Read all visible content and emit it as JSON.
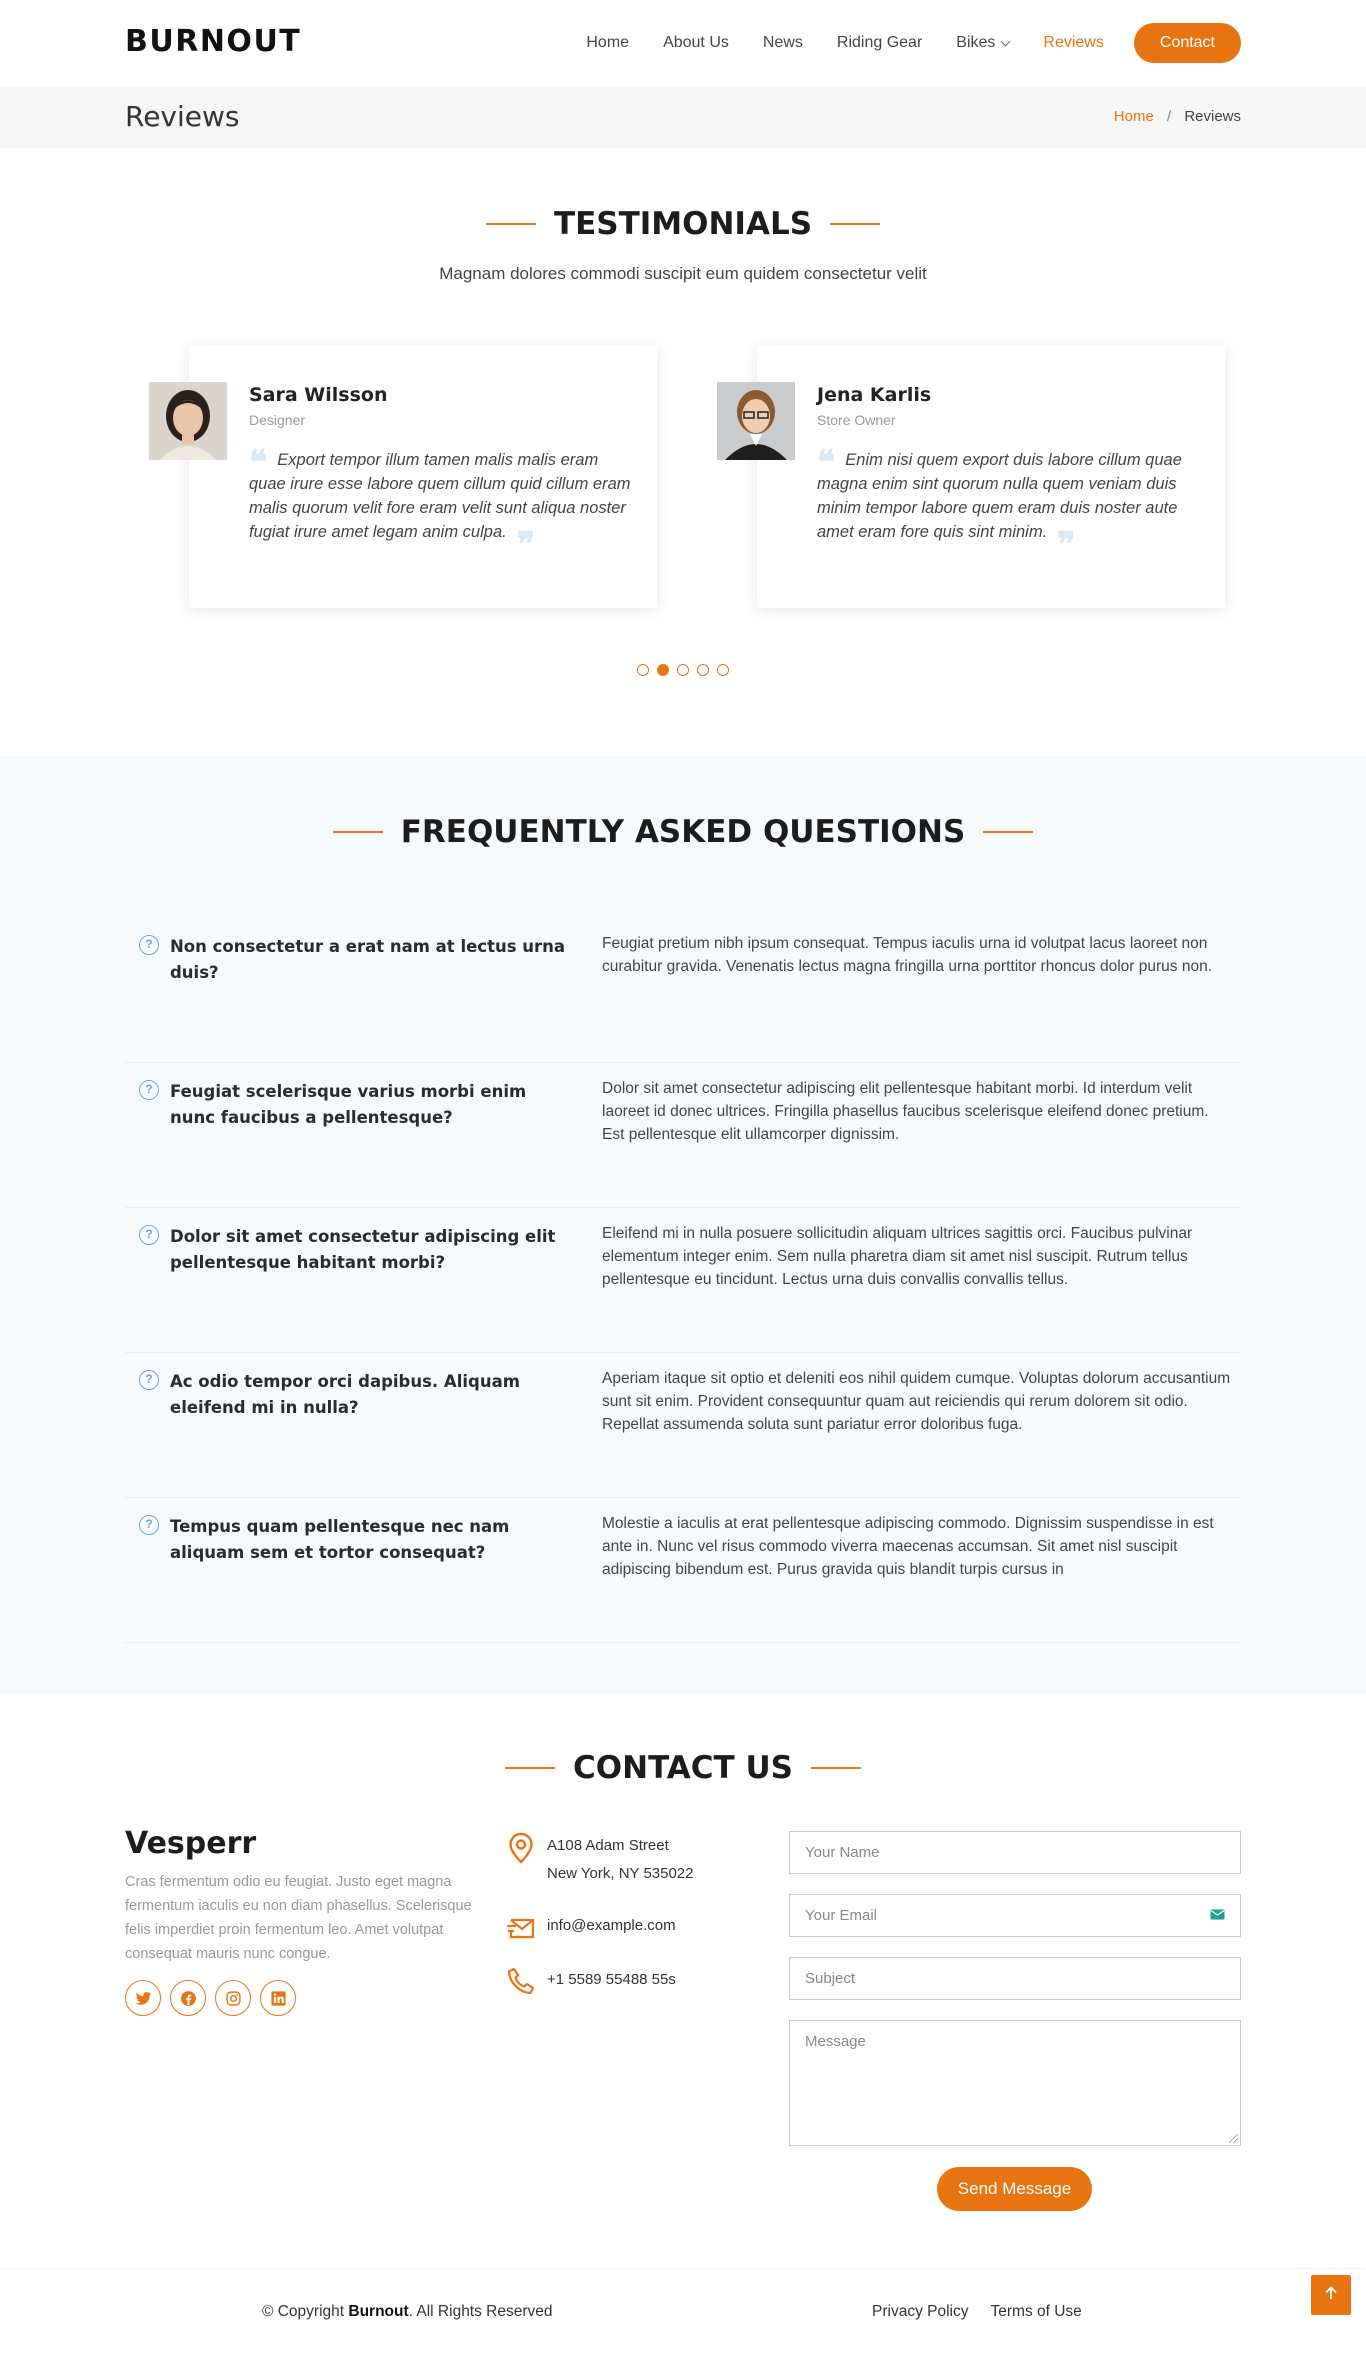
{
  "header": {
    "logo": "BURNOUT",
    "nav": [
      "Home",
      "About Us",
      "News",
      "Riding Gear",
      "Bikes",
      "Reviews"
    ],
    "active_item": "Reviews",
    "contact_button": "Contact"
  },
  "breadcrumbs": {
    "title": "Reviews",
    "home": "Home",
    "separator": "/",
    "current": "Reviews"
  },
  "testimonials": {
    "title": "TESTIMONIALS",
    "subtitle": "Magnam dolores commodi suscipit eum quidem consectetur velit",
    "items": [
      {
        "name": "Sara Wilsson",
        "role": "Designer",
        "quote": "Export tempor illum tamen malis malis eram quae irure esse labore quem cillum quid cillum eram malis quorum velit fore eram velit sunt aliqua noster fugiat irure amet legam anim culpa."
      },
      {
        "name": "Jena Karlis",
        "role": "Store Owner",
        "quote": "Enim nisi quem export duis labore cillum quae magna enim sint quorum nulla quem veniam duis minim tempor labore quem eram duis noster aute amet eram fore quis sint minim."
      }
    ],
    "pagination": {
      "count": 5,
      "active_index": 1
    }
  },
  "faq": {
    "title": "FREQUENTLY ASKED QUESTIONS",
    "items": [
      {
        "q": "Non consectetur a erat nam at lectus urna duis?",
        "a": "Feugiat pretium nibh ipsum consequat. Tempus iaculis urna id volutpat lacus laoreet non curabitur gravida. Venenatis lectus magna fringilla urna porttitor rhoncus dolor purus non."
      },
      {
        "q": "Feugiat scelerisque varius morbi enim nunc faucibus a pellentesque?",
        "a": "Dolor sit amet consectetur adipiscing elit pellentesque habitant morbi. Id interdum velit laoreet id donec ultrices. Fringilla phasellus faucibus scelerisque eleifend donec pretium. Est pellentesque elit ullamcorper dignissim."
      },
      {
        "q": "Dolor sit amet consectetur adipiscing elit pellentesque habitant morbi?",
        "a": "Eleifend mi in nulla posuere sollicitudin aliquam ultrices sagittis orci. Faucibus pulvinar elementum integer enim. Sem nulla pharetra diam sit amet nisl suscipit. Rutrum tellus pellentesque eu tincidunt. Lectus urna duis convallis convallis tellus."
      },
      {
        "q": "Ac odio tempor orci dapibus. Aliquam eleifend mi in nulla?",
        "a": "Aperiam itaque sit optio et deleniti eos nihil quidem cumque. Voluptas dolorum accusantium sunt sit enim. Provident consequuntur quam aut reiciendis qui rerum dolorem sit odio. Repellat assumenda soluta sunt pariatur error doloribus fuga."
      },
      {
        "q": "Tempus quam pellentesque nec nam aliquam sem et tortor consequat?",
        "a": "Molestie a iaculis at erat pellentesque adipiscing commodo. Dignissim suspendisse in est ante in. Nunc vel risus commodo viverra maecenas accumsan. Sit amet nisl suscipit adipiscing bibendum est. Purus gravida quis blandit turpis cursus in"
      }
    ]
  },
  "contact": {
    "title": "CONTACT US",
    "brand": "Vesperr",
    "description": "Cras fermentum odio eu feugiat. Justo eget magna fermentum iaculis eu non diam phasellus. Scelerisque felis imperdiet proin fermentum leo. Amet volutpat consequat mauris nunc congue.",
    "socials": [
      "twitter-icon",
      "facebook-icon",
      "instagram-icon",
      "linkedin-icon"
    ],
    "address_line1": "A108 Adam Street",
    "address_line2": "New York, NY 535022",
    "email": "info@example.com",
    "phone": "+1 5589 55488 55s",
    "form": {
      "name_placeholder": "Your Name",
      "email_placeholder": "Your Email",
      "subject_placeholder": "Subject",
      "message_placeholder": "Message",
      "submit": "Send Message"
    }
  },
  "footer": {
    "copyright_prefix": "© Copyright ",
    "copyright_brand": "Burnout",
    "copyright_suffix": ". All Rights Reserved",
    "links": [
      "Privacy Policy",
      "Terms of Use"
    ]
  },
  "colors": {
    "accent": "#e87511",
    "faq_bg": "#f7fafd",
    "icon_blue": "#6ba7de"
  }
}
